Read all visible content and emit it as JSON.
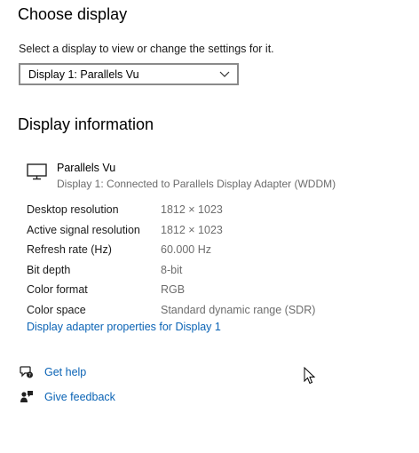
{
  "choose_display": {
    "title": "Choose display",
    "description": "Select a display to view or change the settings for it.",
    "selected_display": "Display 1: Parallels Vu"
  },
  "display_information": {
    "title": "Display information",
    "monitor": {
      "name": "Parallels Vu",
      "subtitle": "Display 1: Connected to Parallels Display Adapter (WDDM)"
    },
    "rows": [
      {
        "label": "Desktop resolution",
        "value": "1812 × 1023"
      },
      {
        "label": "Active signal resolution",
        "value": "1812 × 1023"
      },
      {
        "label": "Refresh rate (Hz)",
        "value": "60.000 Hz"
      },
      {
        "label": "Bit depth",
        "value": "8-bit"
      },
      {
        "label": "Color format",
        "value": "RGB"
      },
      {
        "label": "Color space",
        "value": "Standard dynamic range (SDR)"
      }
    ],
    "adapter_link": "Display adapter properties for Display 1"
  },
  "help": {
    "get_help": "Get help",
    "give_feedback": "Give feedback"
  },
  "icons": {
    "monitor": "monitor-icon",
    "dropdown": "chevron-down-icon",
    "get_help": "get-help-icon",
    "feedback": "feedback-icon",
    "cursor": "mouse-pointer-icon"
  },
  "colors": {
    "link": "#0a63b5",
    "secondary_text": "#6d6d6d",
    "border": "#8a8a8a"
  }
}
